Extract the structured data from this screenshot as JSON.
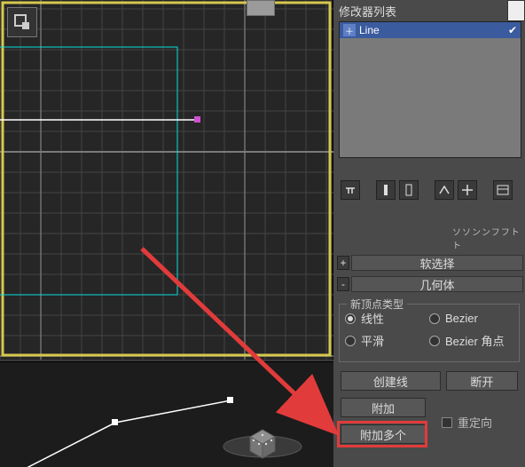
{
  "panel": {
    "modifier_list_label": "修改器列表",
    "mod_stack": {
      "item": "Line"
    },
    "scroll_hint": "ソソンンフフトト"
  },
  "rollouts": {
    "soft_sel": {
      "toggle": "+",
      "label": "软选择"
    },
    "geometry": {
      "toggle": "-",
      "label": "几何体"
    }
  },
  "geometry": {
    "new_vertex_type_title": "新顶点类型",
    "radios": {
      "linear": "线性",
      "bezier": "Bezier",
      "smooth": "平滑",
      "bezier_corner": "Bezier 角点"
    },
    "buttons": {
      "create_line": "创建线",
      "break": "断开",
      "attach": "附加",
      "attach_multi": "附加多个"
    },
    "reorient": "重定向"
  }
}
